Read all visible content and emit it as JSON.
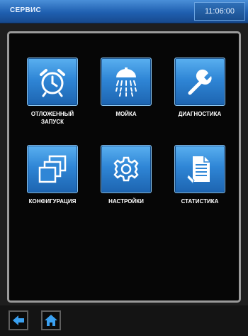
{
  "header": {
    "title": "СЕРВИС",
    "time": "11:06:00"
  },
  "menu": {
    "items": [
      {
        "label": "ОТЛОЖЕННЫЙ\nЗАПУСК",
        "icon": "alarm-clock-icon"
      },
      {
        "label": "МОЙКА",
        "icon": "shower-icon"
      },
      {
        "label": "ДИАГНОСТИКА",
        "icon": "wrench-icon"
      },
      {
        "label": "КОНФИГУРАЦИЯ",
        "icon": "stacked-windows-icon"
      },
      {
        "label": "НАСТРОЙКИ",
        "icon": "gear-icon"
      },
      {
        "label": "СТАТИСТИКА",
        "icon": "document-icon"
      }
    ]
  },
  "footer": {
    "back_icon": "back-arrow-icon",
    "home_icon": "home-icon"
  },
  "colors": {
    "header_blue": "#1f5fb0",
    "tile_blue": "#2f86d6",
    "panel_border": "#9a9a9a",
    "background": "#060606"
  }
}
